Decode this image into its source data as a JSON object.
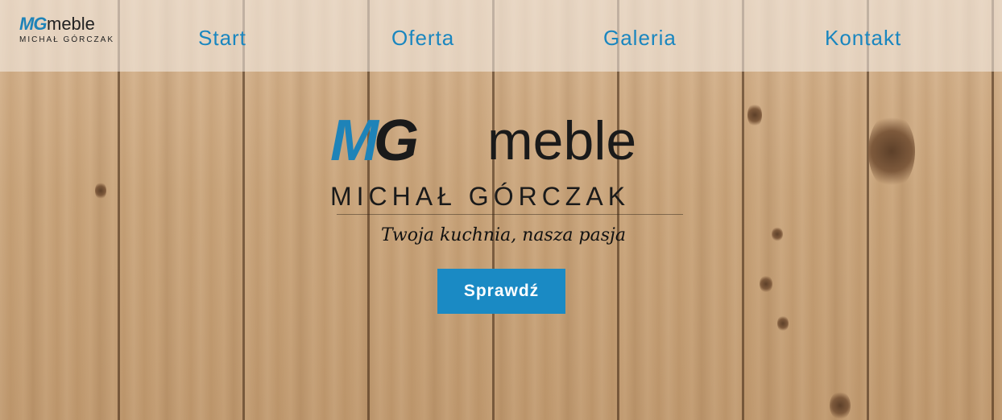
{
  "colors": {
    "accent": "#1a86bf",
    "cta_background": "#1a8ac4",
    "text_dark": "#1a1a1a"
  },
  "brand": {
    "mg": "MG",
    "meble": "meble",
    "subtitle": "MICHAŁ GÓRCZAK"
  },
  "nav": {
    "items": [
      {
        "label": "Start"
      },
      {
        "label": "Oferta"
      },
      {
        "label": "Galeria"
      },
      {
        "label": "Kontakt"
      }
    ]
  },
  "hero": {
    "logo_mg": "M",
    "logo_g": "G",
    "logo_meble": "meble",
    "logo_subtitle": "MICHAŁ GÓRCZAK",
    "tagline": "Twoja kuchnia, nasza pasja",
    "cta_label": "Sprawdź"
  }
}
